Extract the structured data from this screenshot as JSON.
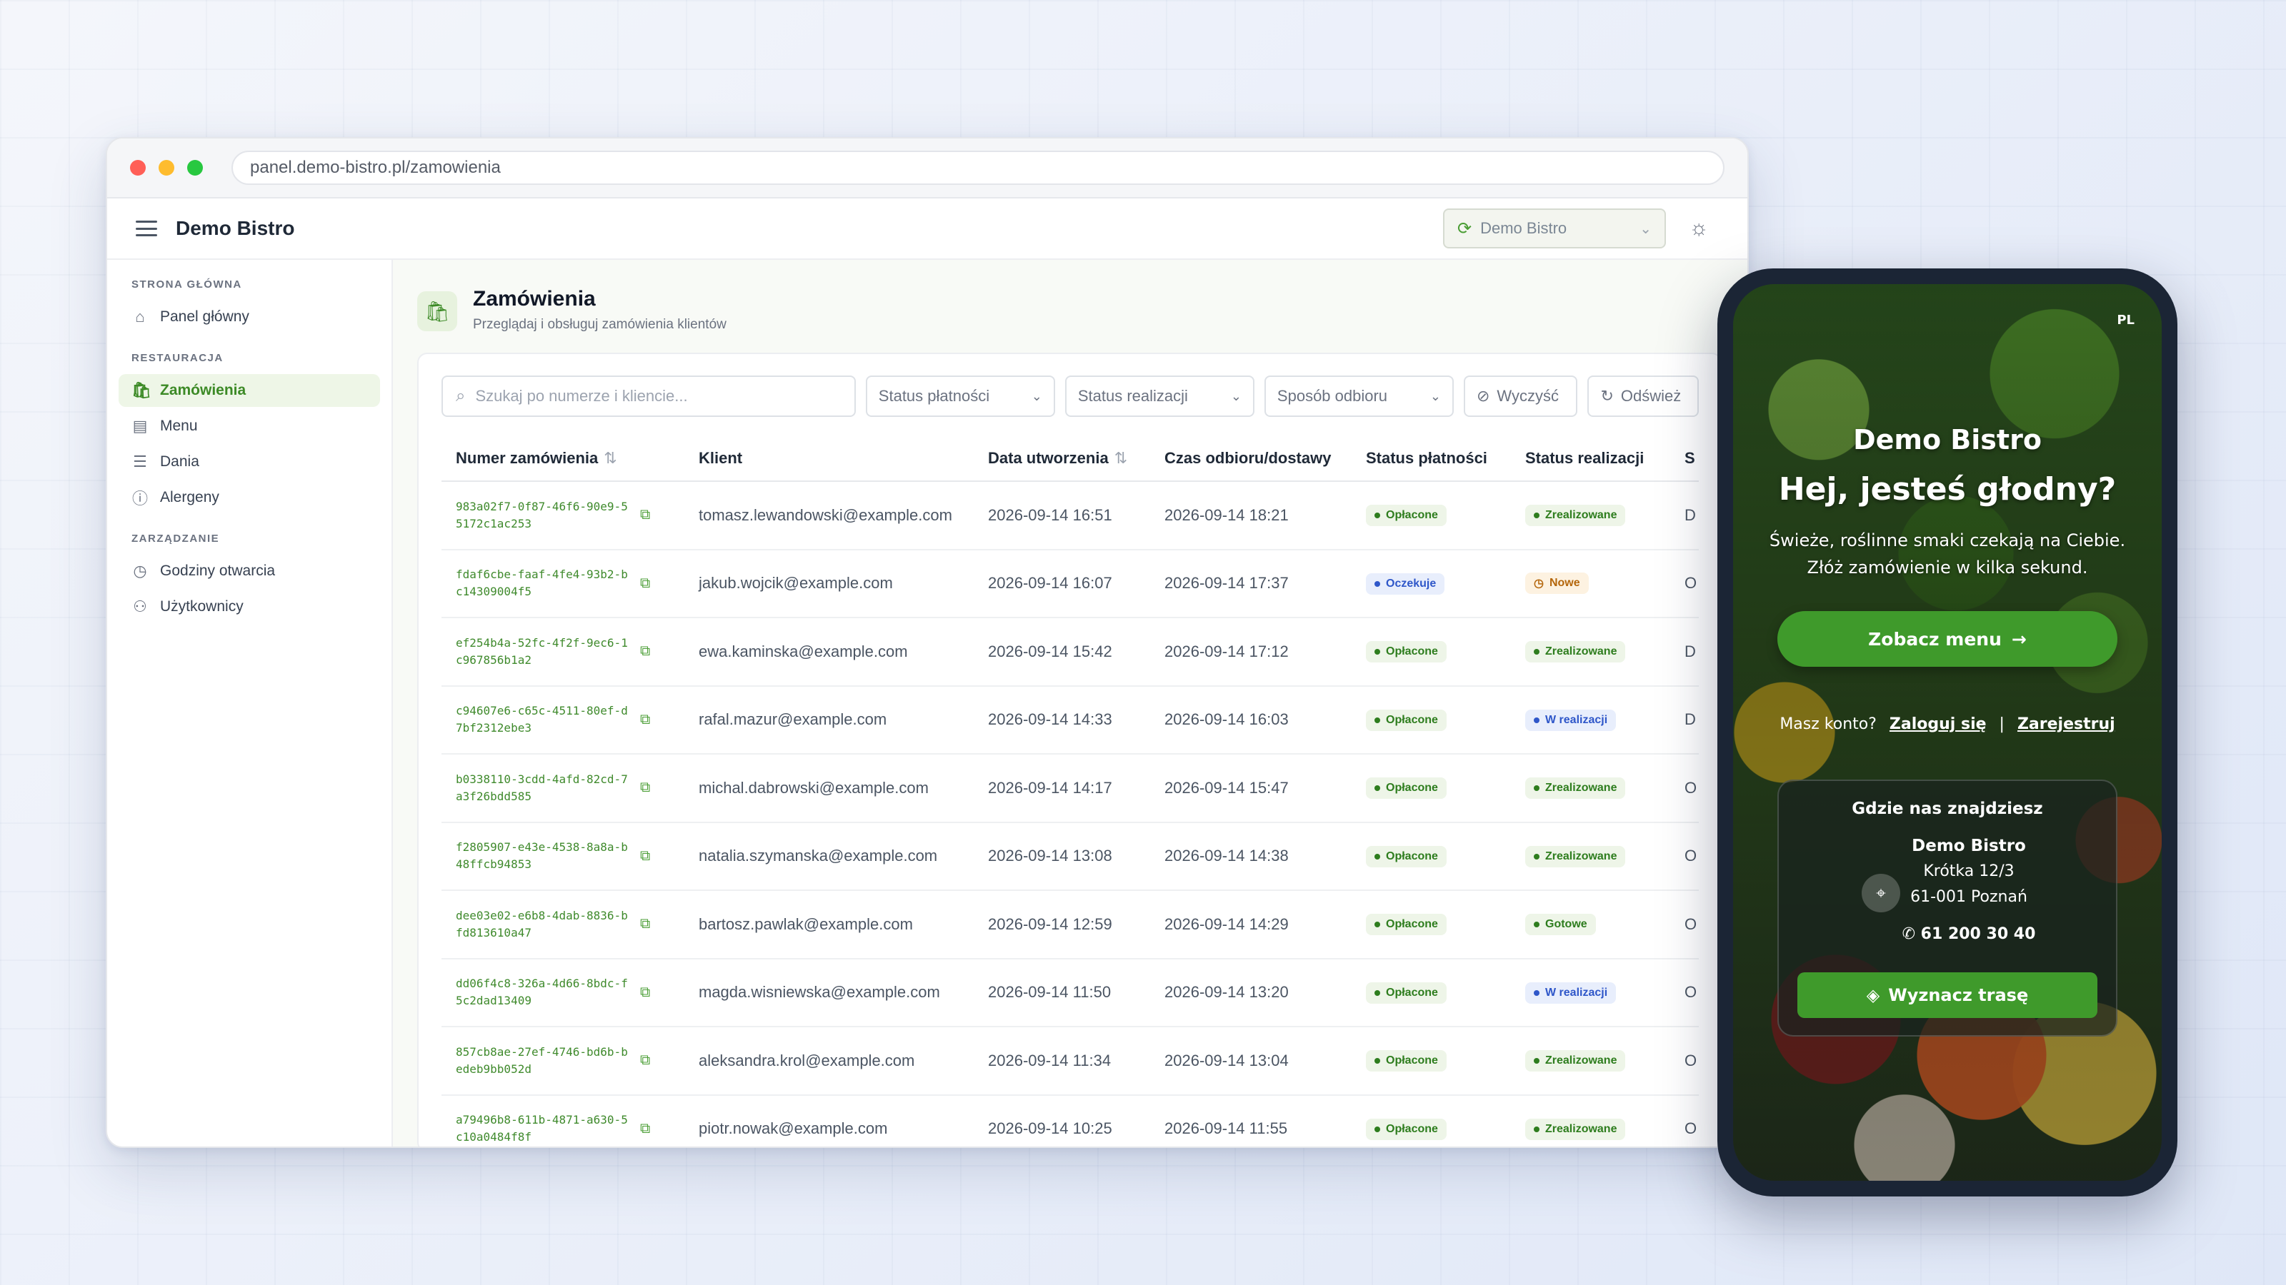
{
  "browser": {
    "url": "panel.demo-bistro.pl/zamowienia"
  },
  "app": {
    "brand": "Demo Bistro",
    "venue_selector": "Demo Bistro"
  },
  "sidebar": {
    "sections": [
      {
        "title": "STRONA GŁÓWNA",
        "items": [
          {
            "label": "Panel główny",
            "icon": "home-icon"
          }
        ]
      },
      {
        "title": "RESTAURACJA",
        "items": [
          {
            "label": "Zamówienia",
            "icon": "bag-icon",
            "active": true
          },
          {
            "label": "Menu",
            "icon": "book-icon"
          },
          {
            "label": "Dania",
            "icon": "list-icon"
          },
          {
            "label": "Alergeny",
            "icon": "alert-icon"
          }
        ]
      },
      {
        "title": "ZARZĄDZANIE",
        "items": [
          {
            "label": "Godziny otwarcia",
            "icon": "clock-icon"
          },
          {
            "label": "Użytkownicy",
            "icon": "users-icon"
          }
        ]
      }
    ]
  },
  "page": {
    "title": "Zamówienia",
    "subtitle": "Przeglądaj i obsługuj zamówienia klientów"
  },
  "filters": {
    "search_placeholder": "Szukaj po numerze i kliencie...",
    "payment_status": "Status płatności",
    "fulfillment_status": "Status realizacji",
    "pickup_method": "Sposób odbioru",
    "clear": "Wyczyść",
    "refresh": "Odśwież"
  },
  "table": {
    "columns": [
      "Numer zamówienia",
      "Klient",
      "Data utworzenia",
      "Czas odbioru/dostawy",
      "Status płatności",
      "Status realizacji",
      "S"
    ],
    "rows": [
      {
        "id": "983a02f7-0f87-46f6-90e9-55172c1ac253",
        "client": "tomasz.lewandowski@example.com",
        "created": "2026-09-14 16:51",
        "pickup": "2026-09-14 18:21",
        "payment": "Opłacone",
        "payment_tone": "green",
        "status": "Zrealizowane",
        "status_tone": "green",
        "extra": "D"
      },
      {
        "id": "fdaf6cbe-faaf-4fe4-93b2-bc14309004f5",
        "client": "jakub.wojcik@example.com",
        "created": "2026-09-14 16:07",
        "pickup": "2026-09-14 17:37",
        "payment": "Oczekuje",
        "payment_tone": "blue",
        "status": "Nowe",
        "status_tone": "amber",
        "extra": "O"
      },
      {
        "id": "ef254b4a-52fc-4f2f-9ec6-1c967856b1a2",
        "client": "ewa.kaminska@example.com",
        "created": "2026-09-14 15:42",
        "pickup": "2026-09-14 17:12",
        "payment": "Opłacone",
        "payment_tone": "green",
        "status": "Zrealizowane",
        "status_tone": "green",
        "extra": "D"
      },
      {
        "id": "c94607e6-c65c-4511-80ef-d7bf2312ebe3",
        "client": "rafal.mazur@example.com",
        "created": "2026-09-14 14:33",
        "pickup": "2026-09-14 16:03",
        "payment": "Opłacone",
        "payment_tone": "green",
        "status": "W realizacji",
        "status_tone": "blue",
        "extra": "D"
      },
      {
        "id": "b0338110-3cdd-4afd-82cd-7a3f26bdd585",
        "client": "michal.dabrowski@example.com",
        "created": "2026-09-14 14:17",
        "pickup": "2026-09-14 15:47",
        "payment": "Opłacone",
        "payment_tone": "green",
        "status": "Zrealizowane",
        "status_tone": "green",
        "extra": "O"
      },
      {
        "id": "f2805907-e43e-4538-8a8a-b48ffcb94853",
        "client": "natalia.szymanska@example.com",
        "created": "2026-09-14 13:08",
        "pickup": "2026-09-14 14:38",
        "payment": "Opłacone",
        "payment_tone": "green",
        "status": "Zrealizowane",
        "status_tone": "green",
        "extra": "O"
      },
      {
        "id": "dee03e02-e6b8-4dab-8836-bfd813610a47",
        "client": "bartosz.pawlak@example.com",
        "created": "2026-09-14 12:59",
        "pickup": "2026-09-14 14:29",
        "payment": "Opłacone",
        "payment_tone": "green",
        "status": "Gotowe",
        "status_tone": "green",
        "extra": "O"
      },
      {
        "id": "dd06f4c8-326a-4d66-8bdc-f5c2dad13409",
        "client": "magda.wisniewska@example.com",
        "created": "2026-09-14 11:50",
        "pickup": "2026-09-14 13:20",
        "payment": "Opłacone",
        "payment_tone": "green",
        "status": "W realizacji",
        "status_tone": "blue",
        "extra": "O"
      },
      {
        "id": "857cb8ae-27ef-4746-bd6b-bedeb9bb052d",
        "client": "aleksandra.krol@example.com",
        "created": "2026-09-14 11:34",
        "pickup": "2026-09-14 13:04",
        "payment": "Opłacone",
        "payment_tone": "green",
        "status": "Zrealizowane",
        "status_tone": "green",
        "extra": "O"
      },
      {
        "id": "a79496b8-611b-4871-a630-5c10a0484f8f",
        "client": "piotr.nowak@example.com",
        "created": "2026-09-14 10:25",
        "pickup": "2026-09-14 11:55",
        "payment": "Opłacone",
        "payment_tone": "green",
        "status": "Zrealizowane",
        "status_tone": "green",
        "extra": "O"
      }
    ]
  },
  "phone": {
    "lang": "PL",
    "brand": "Demo Bistro",
    "hero": "Hej, jesteś głodny?",
    "sub_line1": "Świeże, roślinne smaki czekają na Ciebie.",
    "sub_line2": "Złóż zamówienie w kilka sekund.",
    "cta": "Zobacz menu",
    "account_q": "Masz konto?",
    "login": "Zaloguj się",
    "separator": "|",
    "register": "Zarejestruj",
    "location": {
      "title": "Gdzie nas znajdziesz",
      "name": "Demo Bistro",
      "street": "Krótka 12/3",
      "city": "61-001 Poznań",
      "phone": "61 200 30 40",
      "route_button": "Wyznacz trasę"
    }
  },
  "colors": {
    "accent": "#3f9a2b",
    "accent_dark": "#3c8a26",
    "phone_frame": "#1b2535"
  }
}
